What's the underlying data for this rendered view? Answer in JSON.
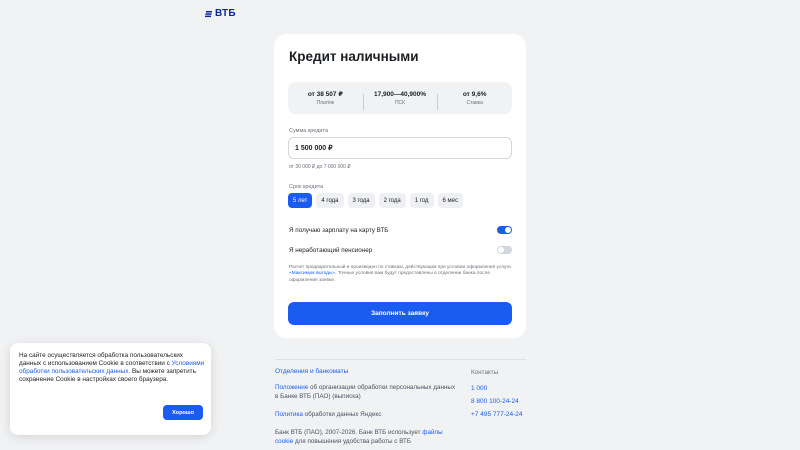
{
  "brand": {
    "name": "ВТБ",
    "accent": "#1a5cf0"
  },
  "form": {
    "title": "Кредит наличными",
    "summary": [
      {
        "value": "от 38 507 ₽",
        "label": "Платёж"
      },
      {
        "value": "17,900—40,900%",
        "label": "ПСК"
      },
      {
        "value": "от 9,6%",
        "label": "Ставка"
      }
    ],
    "amount": {
      "label": "Сумма кредита",
      "value": "1 500 000 ₽",
      "hint": "от 30 000 ₽ до 7 000 000 ₽"
    },
    "term": {
      "label": "Срок кредита",
      "options": [
        "5 лет",
        "4 года",
        "3 года",
        "2 года",
        "1 год",
        "6 мес"
      ],
      "selected": "5 лет"
    },
    "toggles": [
      {
        "label": "Я получаю зарплату на карту ВТБ",
        "on": true
      },
      {
        "label": "Я неработающий пенсионер",
        "on": false
      }
    ],
    "disclaimer": {
      "part1": "Расчет предварительный и произведен по ставкам, действующим при условии оформления услуги",
      "link": "«Максимум выгоды»",
      "part2": ". Точные условия вам будут предоставлены в отделении банка после оформления заявки."
    },
    "submit_label": "Заполнить заявку"
  },
  "footer": {
    "branches_link": "Отделения и банкоматы",
    "regulation_link": "Положение",
    "regulation_text": " об организации обработки персональных данных в Банке ВТБ (ПАО) (выписка)",
    "policy_link": "Политика",
    "policy_text": " обработки данных Яндекс",
    "copyright_text": "Банк ВТБ (ПАО), 2007-2026. Банк ВТБ использует",
    "cookie_link": "файлы cookie",
    "cookie_text": " для повышения удобства работы с ВТБ",
    "contacts_title": "Контакты",
    "phones": [
      "1 000",
      "8 800 100-24-24",
      "+7 495 777-24-24"
    ]
  },
  "cookie_banner": {
    "text1": "На сайте осуществляется обработка пользовательских данных с использованием Cookie в соответствии с ",
    "link": "Условиями обработки пользовательских данных",
    "text2": ". Вы можете запретить сохранение Cookie в настройках своего браузера.",
    "button_label": "Хорошо"
  }
}
